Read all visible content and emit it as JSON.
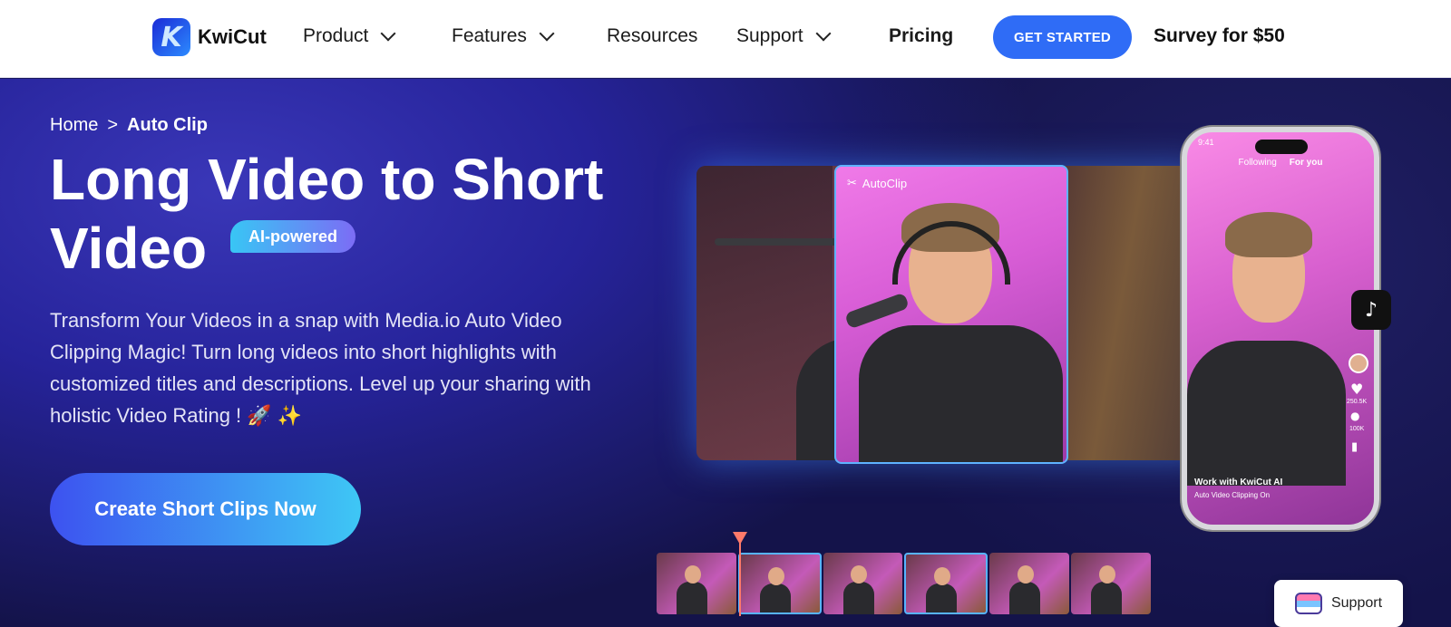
{
  "brand": {
    "name": "KwiCut",
    "logo_letter": "K"
  },
  "nav": {
    "items": [
      {
        "label": "Product",
        "has_dropdown": true
      },
      {
        "label": "Features",
        "has_dropdown": true
      },
      {
        "label": "Resources",
        "has_dropdown": false
      },
      {
        "label": "Support",
        "has_dropdown": true
      },
      {
        "label": "Pricing",
        "has_dropdown": false
      }
    ],
    "cta_label": "GET STARTED",
    "survey_label": "Survey for $50"
  },
  "hero": {
    "breadcrumb": {
      "home": "Home",
      "separator": ">",
      "current": "Auto Clip"
    },
    "headline": "Long Video to Short Video",
    "badge": "AI-powered",
    "description": "Transform Your Videos in a snap with Media.io Auto Video Clipping Magic! Turn long videos into short highlights with customized titles and descriptions. Level up your sharing with holistic Video Rating ! 🚀 ✨",
    "cta_label": "Create Short Clips Now"
  },
  "preview": {
    "clip_label": "AutoClip",
    "phone_tabs": [
      "Following",
      "For you"
    ],
    "phone_time": "9:41",
    "phone_caption_title": "Work with KwiCut AI",
    "phone_caption_sub": "Auto Video Clipping On",
    "likes": "250.5K",
    "comments": "100K"
  },
  "support_widget": {
    "label": "Support"
  },
  "colors": {
    "accent": "#2f6cf6",
    "hero_bg": "#26239a",
    "badge_start": "#38c6f5",
    "badge_end": "#7c6cf5"
  }
}
